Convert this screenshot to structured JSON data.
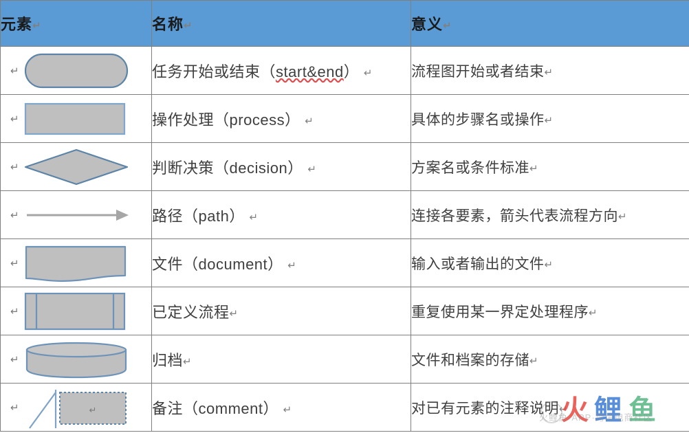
{
  "table": {
    "headers": [
      "元素",
      "名称",
      "意义"
    ],
    "rows": [
      {
        "shape": "rounded-rectangle-stadium",
        "name_cn": "任务开始或结束",
        "name_en": "start&end",
        "name_en_misspelled": true,
        "meaning": "流程图开始或者结束"
      },
      {
        "shape": "rectangle-process",
        "name_cn": "操作处理",
        "name_en": "process",
        "name_en_misspelled": false,
        "meaning": "具体的步骤名或操作"
      },
      {
        "shape": "diamond-decision",
        "name_cn": "判断决策",
        "name_en": "decision",
        "name_en_misspelled": false,
        "meaning": "方案名或条件标准"
      },
      {
        "shape": "arrow-path",
        "name_cn": "路径",
        "name_en": "path",
        "name_en_misspelled": false,
        "meaning": "连接各要素，箭头代表流程方向"
      },
      {
        "shape": "document-wavy",
        "name_cn": "文件",
        "name_en": "document",
        "name_en_misspelled": false,
        "meaning": "输入或者输出的文件"
      },
      {
        "shape": "predefined-process",
        "name_cn": "已定义流程",
        "name_en": "",
        "name_en_misspelled": false,
        "meaning": "重复使用某一界定处理程序"
      },
      {
        "shape": "cylinder-archive",
        "name_cn": "归档",
        "name_en": "",
        "name_en_misspelled": false,
        "meaning": "文件和档案的存储"
      },
      {
        "shape": "comment-callout",
        "name_cn": "备注",
        "name_en": "comment",
        "name_en_misspelled": false,
        "meaning": "对已有元素的注释说明"
      }
    ]
  },
  "marks": {
    "pilcrow": "↵"
  },
  "colors": {
    "header_fill": "#5B9BD5",
    "shape_fill": "#BFBFBF",
    "shape_stroke": "#5B84A8",
    "table_border": "#7F7F7F",
    "arrow": "#A6A6A6",
    "watermark_red": "#E8473F",
    "watermark_blue": "#3C7BD4",
    "watermark_green": "#5FB98A"
  },
  "watermark": {
    "char1": "火",
    "char2": "鲤",
    "char3": "鱼",
    "subtext": "火鲤鱼·APP·跨境电商社区"
  }
}
